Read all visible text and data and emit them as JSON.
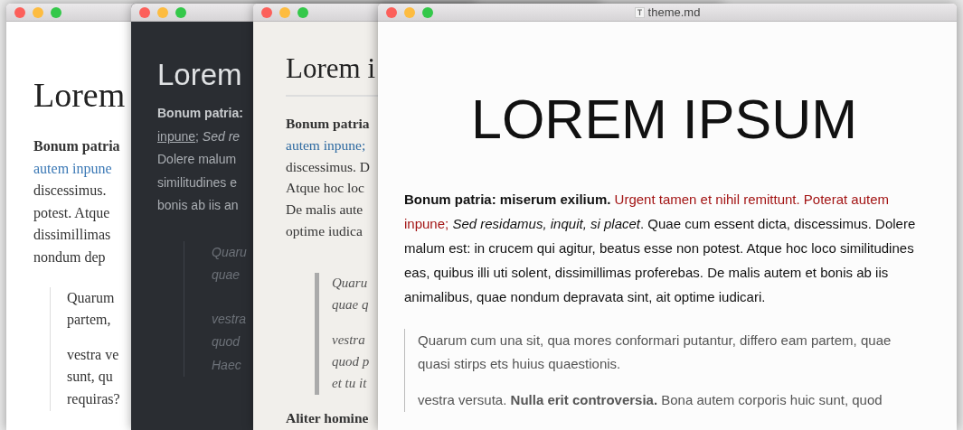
{
  "windows": [
    {
      "kind": "serif",
      "heading": "Lorem",
      "lines": [
        {
          "kind": "lead",
          "text": "Bonum patria"
        },
        {
          "kind": "link",
          "text": "autem inpune"
        },
        {
          "kind": "plain",
          "text": "discessimus."
        },
        {
          "kind": "plain",
          "text": "potest. Atque"
        },
        {
          "kind": "plain",
          "text": "dissimillimas"
        },
        {
          "kind": "plain",
          "text": "nondum dep"
        }
      ],
      "quote": [
        [
          "Quarum",
          "partem,"
        ],
        [
          "vestra ve",
          "sunt, qu",
          "requiras?"
        ]
      ]
    },
    {
      "kind": "dark",
      "heading": "Lorem",
      "lines": [
        {
          "kind": "lead",
          "text": "Bonum patria:"
        },
        {
          "kind": "link",
          "text": "inpune",
          "rest": "; *Sed re*"
        },
        {
          "kind": "plain",
          "text": "Dolere malum"
        },
        {
          "kind": "plain",
          "text": "similitudines e"
        },
        {
          "kind": "plain",
          "text": "bonis ab iis an"
        }
      ],
      "quote": [
        [
          "Quaru",
          "quae"
        ],
        [
          "vestra",
          "quod",
          "Haec"
        ]
      ]
    },
    {
      "kind": "paper",
      "heading": "Lorem i",
      "lines": [
        {
          "kind": "lead",
          "text": "Bonum patria"
        },
        {
          "kind": "link",
          "text": "autem inpune;"
        },
        {
          "kind": "plain",
          "text": "discessimus. D"
        },
        {
          "kind": "plain",
          "text": "Atque hoc loc"
        },
        {
          "kind": "plain",
          "text": "De malis aute"
        },
        {
          "kind": "plain",
          "text": "optime iudica"
        }
      ],
      "quote": [
        [
          "Quaru",
          "quae q"
        ],
        [
          "vestra",
          "quod p",
          "et tu it"
        ]
      ],
      "footer": "Aliter homine"
    },
    {
      "kind": "plain",
      "title": "theme.md",
      "heading": "LOREM IPSUM",
      "paragraph": {
        "lead": "Bonum patria: miserum exilium.",
        "link": "Urgent tamen et nihil remittunt. Poterat autem inpune;",
        "rest": "*Sed residamus, inquit, si placet*. Quae cum essent dicta, discessimus. Dolere malum est: in crucem qui agitur, beatus esse non potest. Atque hoc loco similitudines eas, quibus illi uti solent, dissimillimas proferebas. De malis autem et bonis ab iis animalibus, quae nondum depravata sint, ait optime iudicari."
      },
      "quote": [
        "Quarum cum una sit, qua mores conformari putantur, differo eam partem, quae quasi stirps ets huius quaestionis.",
        "vestra versuta. **Nulla erit controversia.** Bona autem corporis huic sunt, quod"
      ]
    }
  ]
}
